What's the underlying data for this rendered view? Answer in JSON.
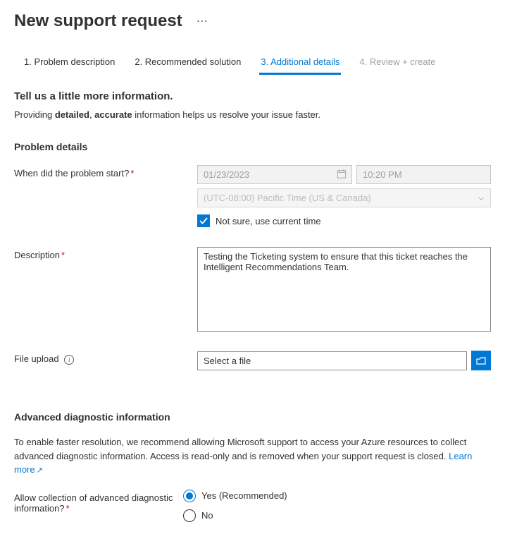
{
  "header": {
    "title": "New support request"
  },
  "tabs": [
    {
      "label": "1. Problem description"
    },
    {
      "label": "2. Recommended solution"
    },
    {
      "label": "3. Additional details"
    },
    {
      "label": "4. Review + create"
    }
  ],
  "intro": {
    "title": "Tell us a little more information.",
    "text_prefix": "Providing ",
    "text_bold1": "detailed",
    "text_sep": ", ",
    "text_bold2": "accurate",
    "text_suffix": " information helps us resolve your issue faster."
  },
  "problem_details": {
    "heading": "Problem details",
    "when_label": "When did the problem start?",
    "date_value": "01/23/2023",
    "time_value": "10:20 PM",
    "timezone_value": "(UTC-08:00) Pacific Time (US & Canada)",
    "not_sure_label": "Not sure, use current time",
    "description_label": "Description",
    "description_value": "Testing the Ticketing system to ensure that this ticket reaches the Intelligent Recommendations Team.",
    "file_upload_label": "File upload",
    "file_placeholder": "Select a file"
  },
  "diagnostic": {
    "heading": "Advanced diagnostic information",
    "text": "To enable faster resolution, we recommend allowing Microsoft support to access your Azure resources to collect advanced diagnostic information. Access is read-only and is removed when your support request is closed. ",
    "learn_more": "Learn more",
    "allow_label": "Allow collection of advanced diagnostic information?",
    "option_yes": "Yes (Recommended)",
    "option_no": "No"
  }
}
